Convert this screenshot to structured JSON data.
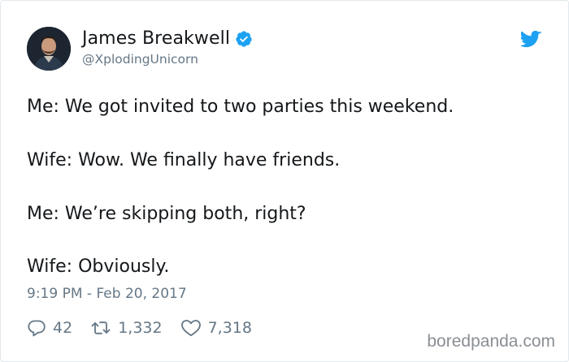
{
  "author": {
    "name": "James Breakwell",
    "handle": "@XplodingUnicorn",
    "verified": true,
    "avatar_icon": "profile-photo"
  },
  "tweet": {
    "lines": [
      "Me: We got invited to two parties this weekend.",
      "Wife: Wow. We finally have friends.",
      "Me: We’re skipping both, right?",
      "Wife: Obviously."
    ],
    "timestamp": "9:19 PM - Feb 20, 2017"
  },
  "stats": {
    "replies": "42",
    "retweets": "1,332",
    "likes": "7,318"
  },
  "icons": {
    "brand": "twitter-bird-icon",
    "reply": "reply-icon",
    "retweet": "retweet-icon",
    "like": "heart-icon",
    "verified": "verified-badge-icon"
  },
  "colors": {
    "twitter_blue": "#1da1f2",
    "text": "#14171a",
    "muted": "#657786"
  },
  "watermark": "boredpanda.com"
}
